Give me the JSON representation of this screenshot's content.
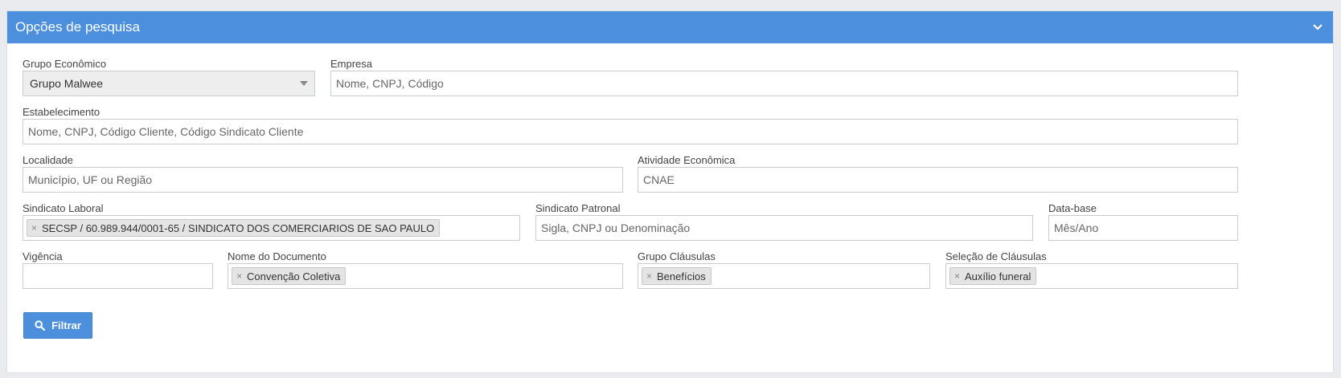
{
  "panel": {
    "title": "Opções de pesquisa",
    "toggle_icon": "chevron-down-icon"
  },
  "fields": {
    "grupo_economico": {
      "label": "Grupo Econômico",
      "value": "Grupo Malwee"
    },
    "empresa": {
      "label": "Empresa",
      "placeholder": "Nome, CNPJ, Código"
    },
    "estabelecimento": {
      "label": "Estabelecimento",
      "placeholder": "Nome, CNPJ, Código Cliente, Código Sindicato Cliente"
    },
    "localidade": {
      "label": "Localidade",
      "placeholder": "Município, UF ou Região"
    },
    "atividade_economica": {
      "label": "Atividade Econômica",
      "placeholder": "CNAE"
    },
    "sindicato_laboral": {
      "label": "Sindicato Laboral",
      "tag": "SECSP / 60.989.944/0001-65 / SINDICATO DOS COMERCIARIOS DE SAO PAULO"
    },
    "sindicato_patronal": {
      "label": "Sindicato Patronal",
      "placeholder": "Sigla, CNPJ ou Denominação"
    },
    "data_base": {
      "label": "Data-base",
      "placeholder": "Mês/Ano"
    },
    "vigencia": {
      "label": "Vigência",
      "value": ""
    },
    "nome_documento": {
      "label": "Nome do Documento",
      "tag": "Convenção Coletiva"
    },
    "grupo_clausulas": {
      "label": "Grupo Cláusulas",
      "tag": "Benefícios"
    },
    "selecao_clausulas": {
      "label": "Seleção de Cláusulas",
      "tag": "Auxílio funeral"
    }
  },
  "tag_remove_symbol": "×",
  "filter_button": {
    "label": "Filtrar",
    "icon": "search-icon"
  },
  "colors": {
    "header": "#4c8fdc",
    "button": "#4c8fdc"
  }
}
